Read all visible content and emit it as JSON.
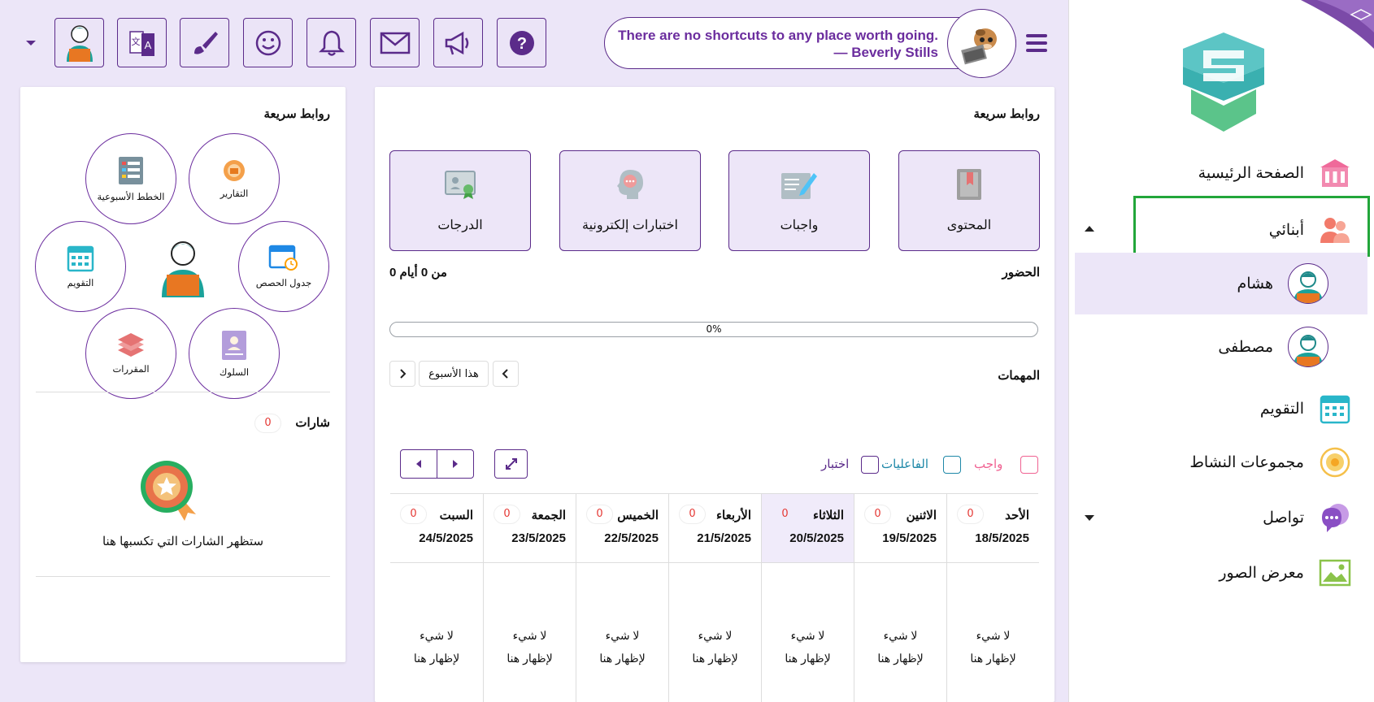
{
  "topbar": {
    "quote_line1": "There are no shortcuts to any place worth going.",
    "quote_line2": "— Beverly Stills",
    "buttons": [
      "avatar-button",
      "translate-button",
      "theme-button",
      "emoji-button",
      "notifications-button",
      "messages-button",
      "announcements-button",
      "help-button"
    ]
  },
  "sidebar": {
    "home": "الصفحة الرئيسية",
    "children": "أبنائي",
    "child1": "هشام",
    "child2": "مصطفى",
    "calendar": "التقويم",
    "activity": "مجموعات النشاط",
    "communication": "تواصل",
    "gallery": "معرض الصور"
  },
  "main": {
    "quick_links_title": "روابط سريعة",
    "links": [
      "المحتوى",
      "واجبات",
      "اختبارات إلكترونية",
      "الدرجات"
    ],
    "attendance_title": "الحضور",
    "attendance_value": "0 من 0 أيام",
    "progress_label": "0%",
    "tasks_title": "المهمات",
    "this_week": "هذا الأسبوع",
    "legend": {
      "homework": "واجب",
      "activities": "الفاعليات",
      "exam": "اختبار"
    },
    "days": [
      {
        "name": "الأحد",
        "date": "18/5/2025",
        "count": "0",
        "empty": "لا شيء لإظهار هنا"
      },
      {
        "name": "الاثنين",
        "date": "19/5/2025",
        "count": "0",
        "empty": "لا شيء لإظهار هنا"
      },
      {
        "name": "الثلاثاء",
        "date": "20/5/2025",
        "count": "0",
        "empty": "لا شيء لإظهار هنا"
      },
      {
        "name": "الأربعاء",
        "date": "21/5/2025",
        "count": "0",
        "empty": "لا شيء لإظهار هنا"
      },
      {
        "name": "الخميس",
        "date": "22/5/2025",
        "count": "0",
        "empty": "لا شيء لإظهار هنا"
      },
      {
        "name": "الجمعة",
        "date": "23/5/2025",
        "count": "0",
        "empty": "لا شيء لإظهار هنا"
      },
      {
        "name": "السبت",
        "date": "24/5/2025",
        "count": "0",
        "empty": "لا شيء لإظهار هنا"
      }
    ]
  },
  "side": {
    "quick_links_title": "روابط سريعة",
    "circles": {
      "reports": "التقارير",
      "weekly_plans": "الخطط الأسبوعية",
      "schedule": "جدول الحصص",
      "calendar": "التقويم",
      "behavior": "السلوك",
      "courses": "المقررات"
    },
    "badges_title": "شارات",
    "badges_count": "0",
    "badges_empty": "ستظهر الشارات التي تكسبها هنا"
  },
  "colors": {
    "accent": "#5b2b8a",
    "highlight": "#22a63a",
    "today": "#f0ebfa"
  }
}
